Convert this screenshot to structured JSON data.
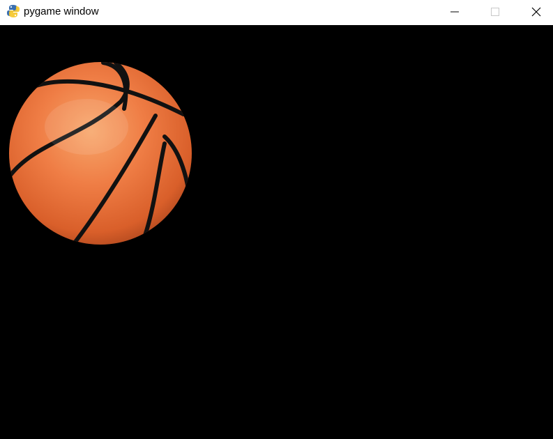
{
  "window": {
    "title": "pygame window",
    "icon": "python-snake-icon",
    "controls": {
      "minimize": "minimize-icon",
      "maximize": "maximize-icon",
      "close": "close-icon"
    }
  },
  "canvas": {
    "background_color": "#000000",
    "sprite": "basketball-image"
  },
  "colors": {
    "titlebar": "#ffffff",
    "ball_orange": "#e8703a",
    "ball_seams": "#111111"
  }
}
